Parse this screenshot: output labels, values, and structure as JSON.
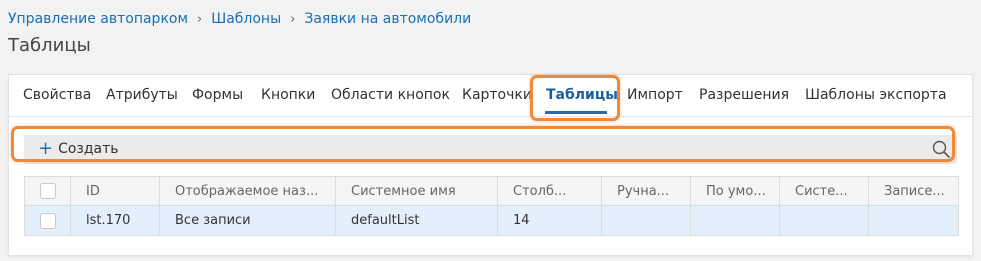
{
  "breadcrumb": {
    "items": [
      "Управление автопарком",
      "Шаблоны",
      "Заявки на автомобили"
    ],
    "separator": "›"
  },
  "page_title": "Таблицы",
  "tabs": [
    {
      "label": "Свойства"
    },
    {
      "label": "Атрибуты"
    },
    {
      "label": "Формы"
    },
    {
      "label": "Кнопки"
    },
    {
      "label": "Области кнопок"
    },
    {
      "label": "Карточки"
    },
    {
      "label": "Таблицы",
      "active": true
    },
    {
      "label": "Импорт"
    },
    {
      "label": "Разрешения"
    },
    {
      "label": "Шаблоны экспорта"
    }
  ],
  "toolbar": {
    "create_label": "Создать",
    "create_icon": "plus-icon",
    "search_icon": "search-icon"
  },
  "table": {
    "columns": [
      "ID",
      "Отображаемое наз...",
      "Системное имя",
      "Столб...",
      "Ручна...",
      "По умо...",
      "Систе...",
      "Записе..."
    ],
    "rows": [
      {
        "cells": [
          "lst.170",
          "Все записи",
          "defaultList",
          "14",
          "",
          "",
          "",
          ""
        ]
      }
    ]
  },
  "colors": {
    "accent": "#1a6fb5",
    "highlight": "#f0883a",
    "selected_row": "#e3f0fb"
  }
}
